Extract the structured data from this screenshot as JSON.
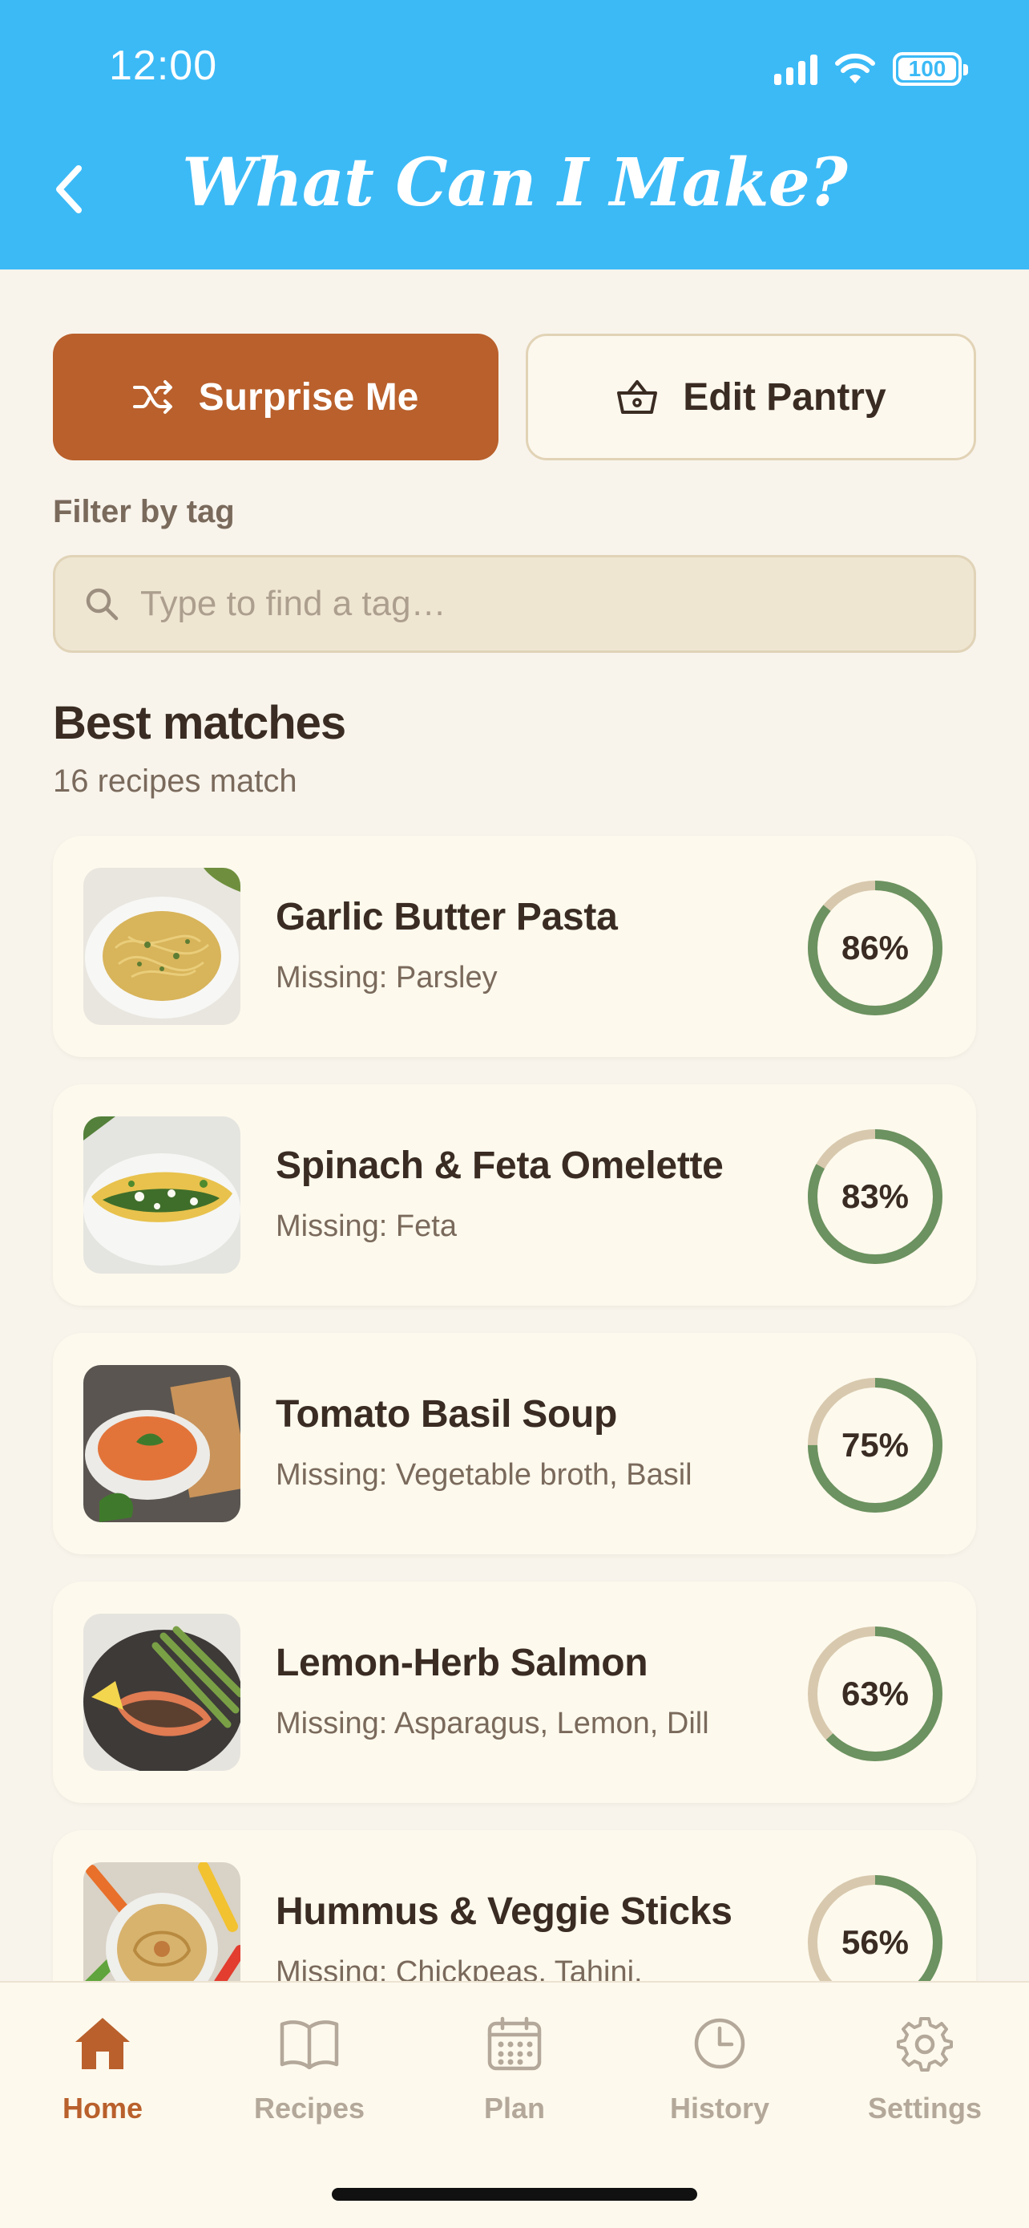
{
  "status_bar": {
    "time": "12:00",
    "battery": "100"
  },
  "header": {
    "title": "What Can I Make?"
  },
  "actions": {
    "surprise_label": "Surprise Me",
    "pantry_label": "Edit Pantry"
  },
  "filter": {
    "label": "Filter by tag",
    "placeholder": "Type to find a tag…",
    "value": ""
  },
  "section": {
    "title": "Best matches",
    "subtitle": "16 recipes match"
  },
  "recipes": [
    {
      "name": "Garlic Butter Pasta",
      "missing": "Missing: Parsley",
      "match_label": "86%",
      "match": 0.86
    },
    {
      "name": "Spinach & Feta Omelette",
      "missing": "Missing: Feta",
      "match_label": "83%",
      "match": 0.83
    },
    {
      "name": "Tomato Basil Soup",
      "missing": "Missing: Vegetable broth, Basil",
      "match_label": "75%",
      "match": 0.75
    },
    {
      "name": "Lemon-Herb Salmon",
      "missing": "Missing: Asparagus, Lemon, Dill",
      "match_label": "63%",
      "match": 0.63
    },
    {
      "name": "Hummus & Veggie Sticks",
      "missing": "Missing: Chickpeas, Tahini,",
      "match_label": "56%",
      "match": 0.56
    }
  ],
  "tabs": [
    {
      "label": "Home",
      "icon": "house-icon",
      "active": true
    },
    {
      "label": "Recipes",
      "icon": "book-icon",
      "active": false
    },
    {
      "label": "Plan",
      "icon": "calendar-icon",
      "active": false
    },
    {
      "label": "History",
      "icon": "clock-icon",
      "active": false
    },
    {
      "label": "Settings",
      "icon": "gear-icon",
      "active": false
    }
  ],
  "colors": {
    "header": "#3cbaf6",
    "accent": "#b9602c",
    "ring_progress": "#6b9260",
    "ring_track": "#d8c9ae",
    "background": "#f8f4ec"
  }
}
